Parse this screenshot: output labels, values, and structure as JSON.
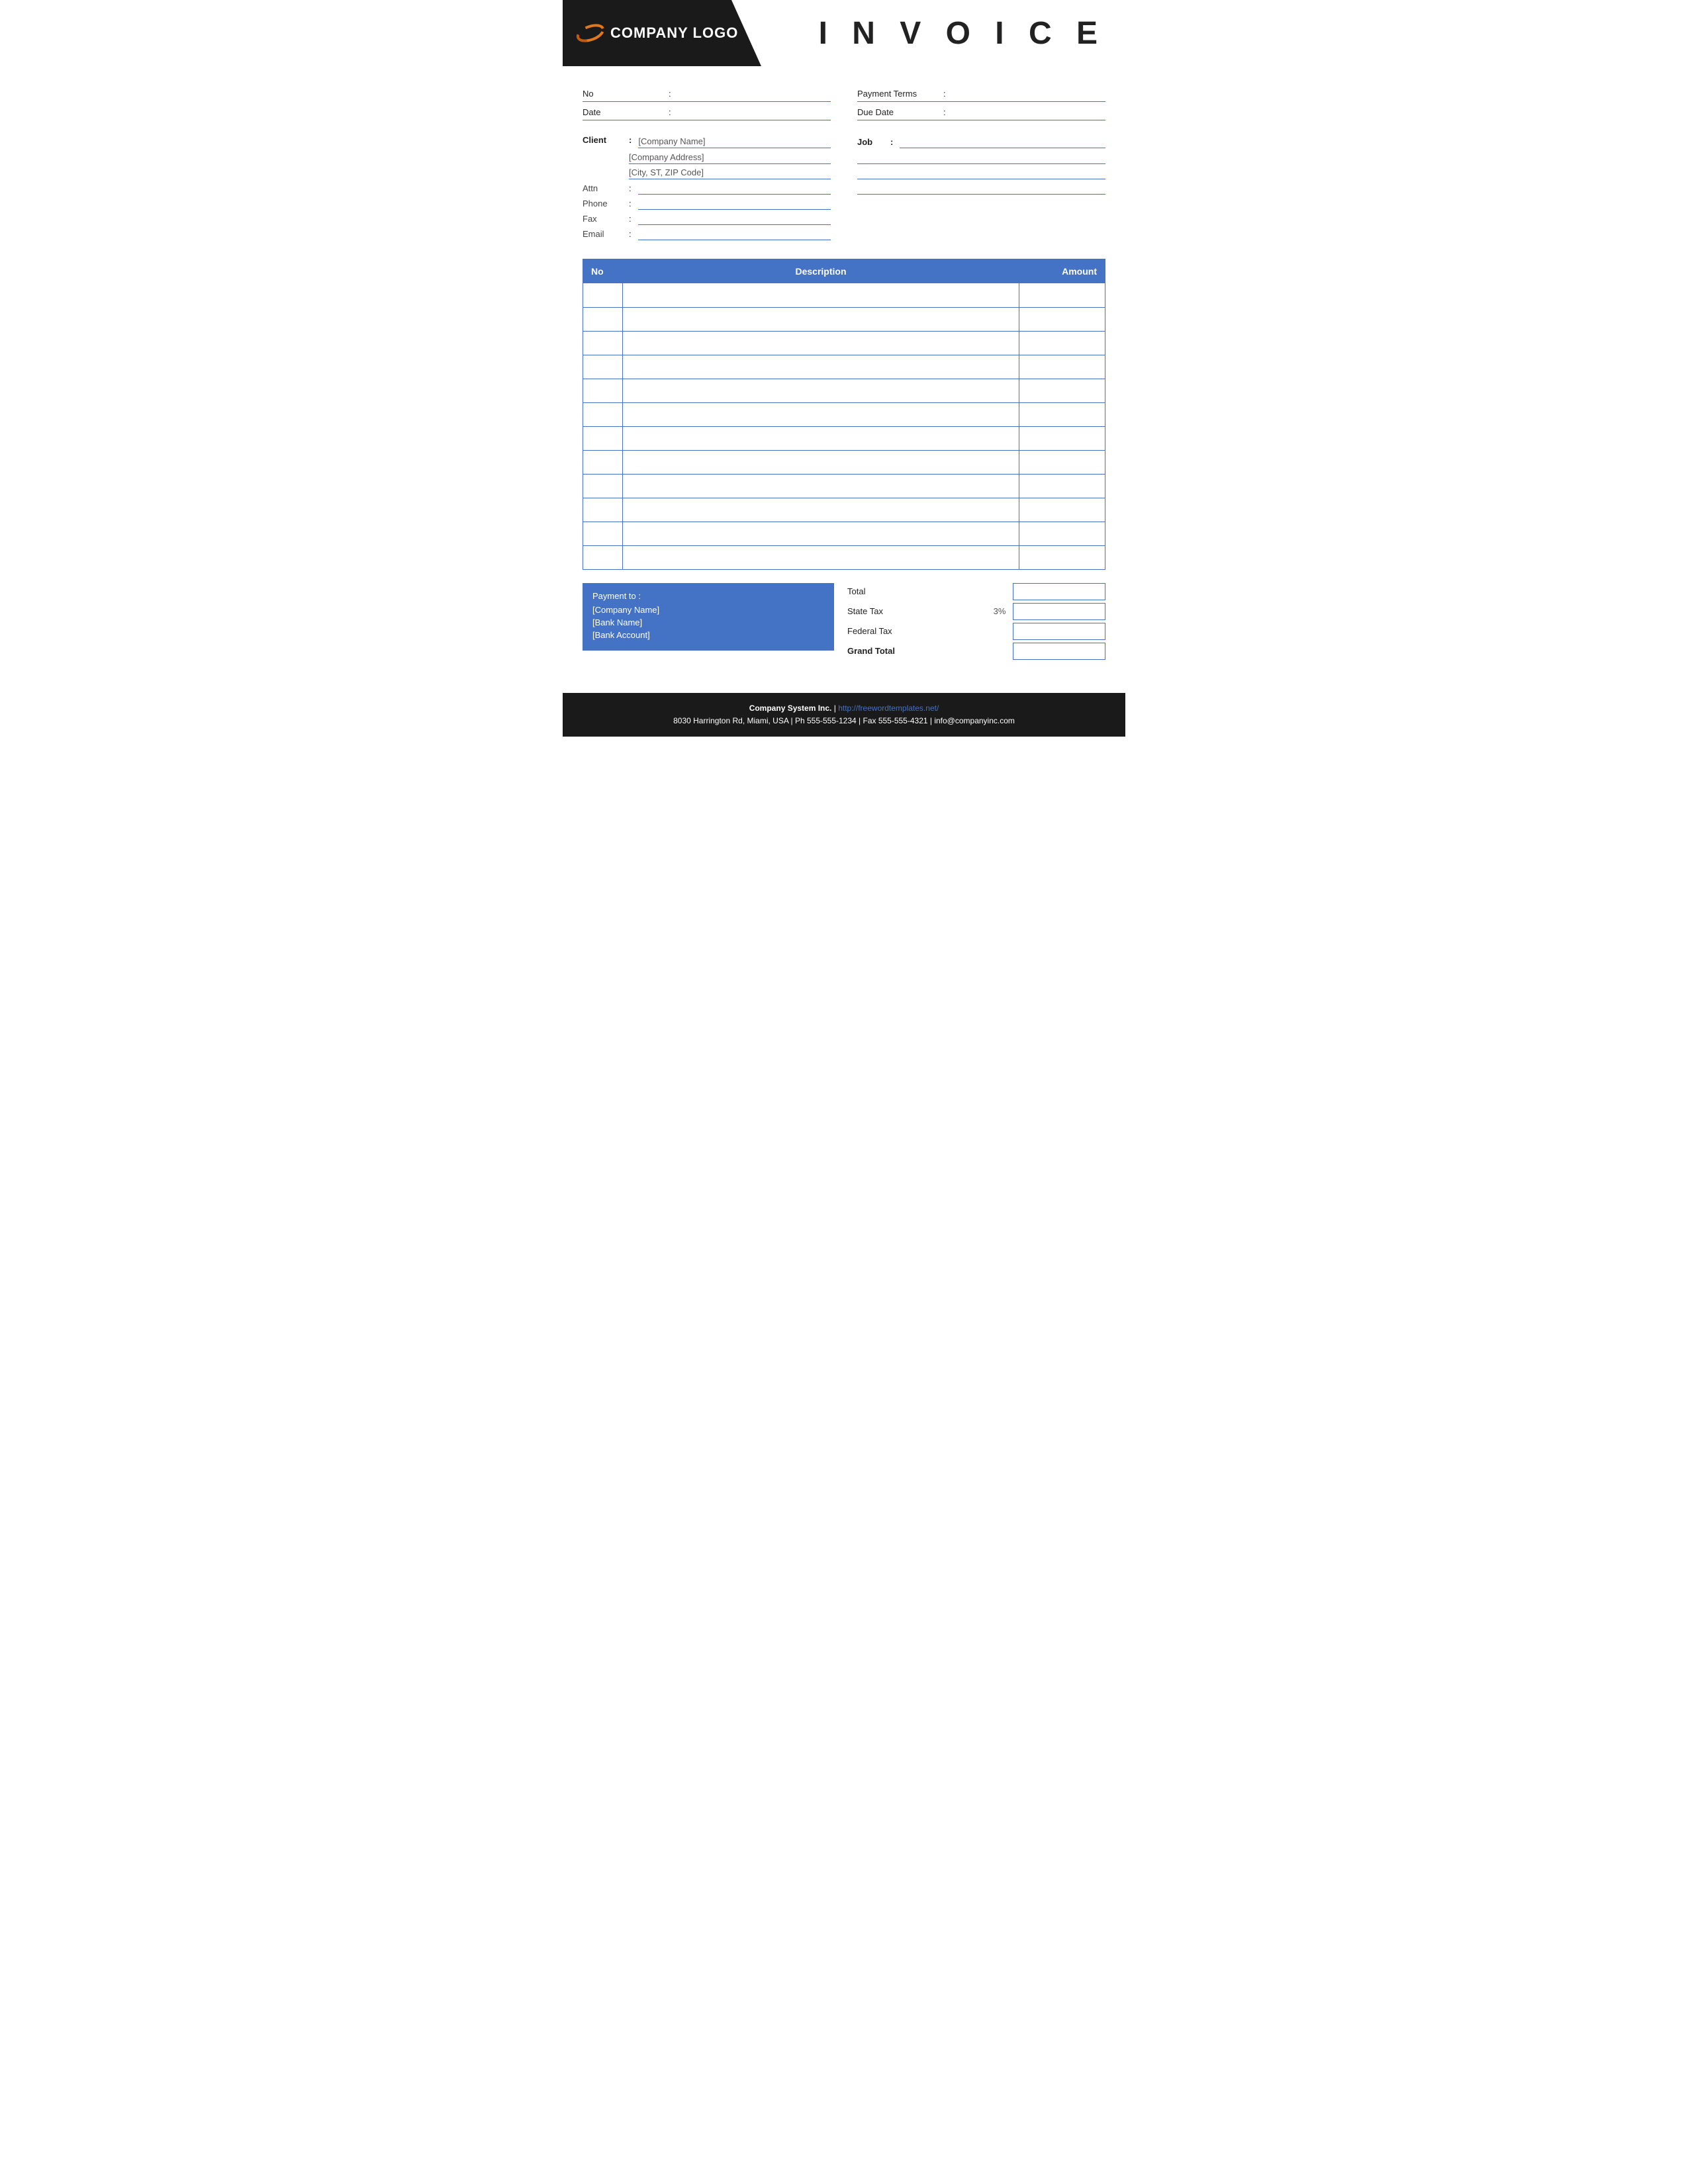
{
  "header": {
    "logo_text": "COMPANY LOGO",
    "invoice_title": "I N V O I C E"
  },
  "info": {
    "no_label": "No",
    "no_colon": ":",
    "no_value": "",
    "payment_terms_label": "Payment  Terms",
    "payment_terms_colon": ":",
    "payment_terms_value": "",
    "date_label": "Date",
    "date_colon": ":",
    "date_value": "",
    "due_date_label": "Due Date",
    "due_date_colon": ":",
    "due_date_value": ""
  },
  "client": {
    "label": "Client",
    "colon": ":",
    "company_name": "[Company Name]",
    "company_address": "[Company Address]",
    "city_zip": "[City, ST, ZIP Code]",
    "attn_label": "Attn",
    "attn_colon": ":",
    "attn_value": "",
    "phone_label": "Phone",
    "phone_colon": ":",
    "phone_value": "",
    "fax_label": "Fax",
    "fax_colon": ":",
    "fax_value": "",
    "email_label": "Email",
    "email_colon": ":",
    "email_value": ""
  },
  "job": {
    "label": "Job",
    "colon": ":",
    "fields": [
      "",
      "",
      "",
      ""
    ]
  },
  "table": {
    "col_no": "No",
    "col_description": "Description",
    "col_amount": "Amount",
    "rows": [
      {
        "no": "",
        "description": "",
        "amount": ""
      },
      {
        "no": "",
        "description": "",
        "amount": ""
      },
      {
        "no": "",
        "description": "",
        "amount": ""
      },
      {
        "no": "",
        "description": "",
        "amount": ""
      },
      {
        "no": "",
        "description": "",
        "amount": ""
      },
      {
        "no": "",
        "description": "",
        "amount": ""
      },
      {
        "no": "",
        "description": "",
        "amount": ""
      },
      {
        "no": "",
        "description": "",
        "amount": ""
      },
      {
        "no": "",
        "description": "",
        "amount": ""
      },
      {
        "no": "",
        "description": "",
        "amount": ""
      },
      {
        "no": "",
        "description": "",
        "amount": ""
      },
      {
        "no": "",
        "description": "",
        "amount": ""
      }
    ]
  },
  "payment": {
    "label": "Payment to :",
    "company_name": "[Company Name]",
    "bank_name": "[Bank Name]",
    "bank_account": "[Bank Account]"
  },
  "totals": {
    "total_label": "Total",
    "state_tax_label": "State Tax",
    "state_tax_percent": "3%",
    "federal_tax_label": "Federal Tax",
    "grand_total_label": "Grand Total",
    "total_value": "",
    "state_tax_value": "",
    "federal_tax_value": "",
    "grand_total_value": ""
  },
  "footer": {
    "company": "Company System Inc.",
    "separator": "|",
    "url": "http://freewordtemplates.net/",
    "address": "8030 Harrington Rd, Miami, USA | Ph 555-555-1234 | Fax 555-555-4321 | info@companyinc.com"
  }
}
